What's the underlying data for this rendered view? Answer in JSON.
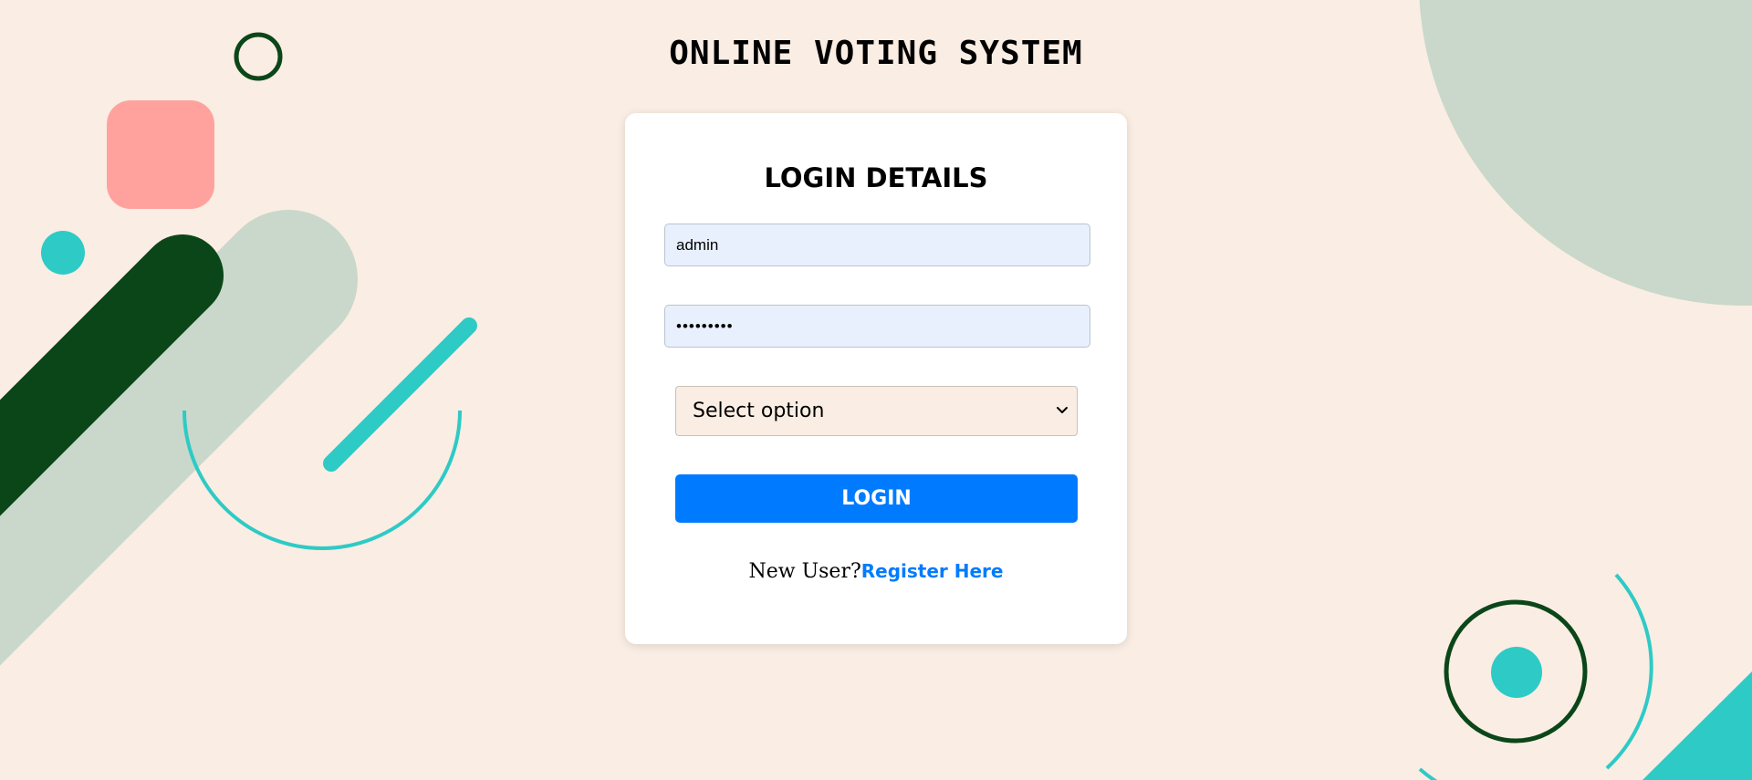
{
  "header": {
    "title": "ONLINE VOTING SYSTEM"
  },
  "login_card": {
    "title": "LOGIN DETAILS",
    "username": {
      "value": "admin"
    },
    "password": {
      "value": "123456789"
    },
    "role_select": {
      "selected": "Select option"
    },
    "login_button": "LOGIN",
    "new_user_text": "New User?",
    "register_link": "Register Here"
  },
  "colors": {
    "background": "#FAEDE3",
    "dark_green": "#0B4619",
    "sage": "#C9D8CA",
    "teal": "#2ECAC6",
    "coral": "#FFA29E",
    "button_blue": "#007BFF",
    "input_blue": "#E8F0FE"
  },
  "decorations": {
    "shapes": [
      "ring",
      "rounded-square",
      "dot",
      "diagonal-bar",
      "diagonal-line",
      "arc",
      "quarter-circle",
      "target-ring",
      "corner-triangle"
    ]
  }
}
